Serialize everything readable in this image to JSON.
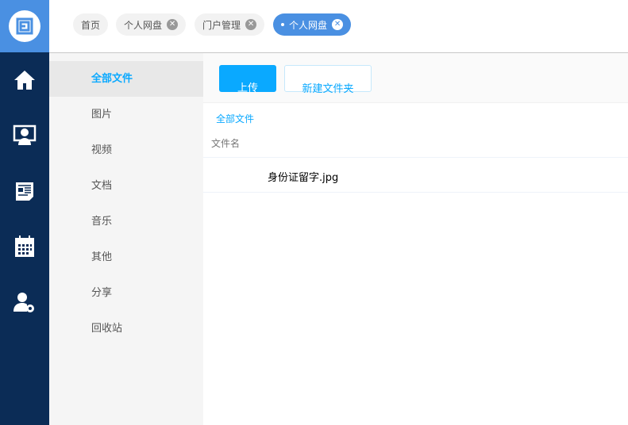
{
  "tabs": [
    {
      "label": "首页",
      "closable": false
    },
    {
      "label": "个人网盘",
      "closable": true
    },
    {
      "label": "门户管理",
      "closable": true
    },
    {
      "label": "个人网盘",
      "closable": true,
      "active": true
    }
  ],
  "rail": [
    "home-icon",
    "monitor-user-icon",
    "news-icon",
    "calendar-icon",
    "user-settings-icon"
  ],
  "sidebar": {
    "items": [
      "全部文件",
      "图片",
      "视频",
      "文档",
      "音乐",
      "其他",
      "分享",
      "回收站"
    ],
    "active": 0
  },
  "toolbar": {
    "upload": "上传",
    "new_folder": "新建文件夹"
  },
  "breadcrumb": "全部文件",
  "table": {
    "header": "文件名",
    "rows": [
      {
        "name": "身份证留字.jpg"
      }
    ]
  },
  "colors": {
    "rail": "#0b2c56",
    "accent": "#4a90e2",
    "primary": "#0aa9ff"
  }
}
